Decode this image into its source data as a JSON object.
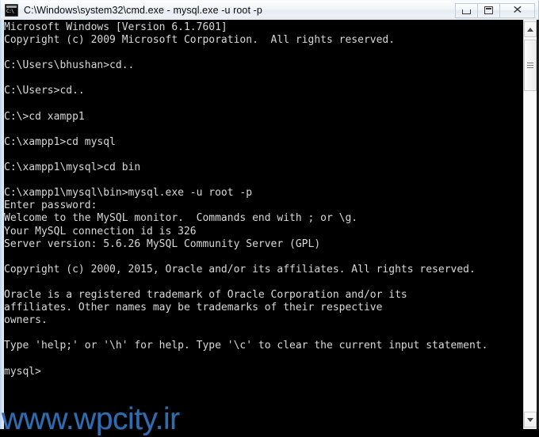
{
  "window": {
    "title": "C:\\Windows\\system32\\cmd.exe - mysql.exe  -u root -p",
    "icon_name": "cmd-exe-icon",
    "icon_text": "C:\\",
    "controls": {
      "minimize_label": "–",
      "maximize_label": "□",
      "close_label": "✕"
    }
  },
  "console": {
    "lines": [
      "Microsoft Windows [Version 6.1.7601]",
      "Copyright (c) 2009 Microsoft Corporation.  All rights reserved.",
      "",
      "C:\\Users\\bhushan>cd..",
      "",
      "C:\\Users>cd..",
      "",
      "C:\\>cd xampp1",
      "",
      "C:\\xampp1>cd mysql",
      "",
      "C:\\xampp1\\mysql>cd bin",
      "",
      "C:\\xampp1\\mysql\\bin>mysql.exe -u root -p",
      "Enter password:",
      "Welcome to the MySQL monitor.  Commands end with ; or \\g.",
      "Your MySQL connection id is 326",
      "Server version: 5.6.26 MySQL Community Server (GPL)",
      "",
      "Copyright (c) 2000, 2015, Oracle and/or its affiliates. All rights reserved.",
      "",
      "Oracle is a registered trademark of Oracle Corporation and/or its",
      "affiliates. Other names may be trademarks of their respective",
      "owners.",
      "",
      "Type 'help;' or '\\h' for help. Type '\\c' to clear the current input statement.",
      "",
      "mysql>"
    ],
    "prompt": "mysql>",
    "background_color": "#000000",
    "text_color": "#d8d8d8"
  },
  "scrollbar": {
    "up_arrow": "up-arrow",
    "down_arrow": "down-arrow",
    "thumb": "scroll-thumb"
  },
  "watermark": {
    "text": "www.wpcity.ir",
    "color": "#2f6cb0"
  }
}
